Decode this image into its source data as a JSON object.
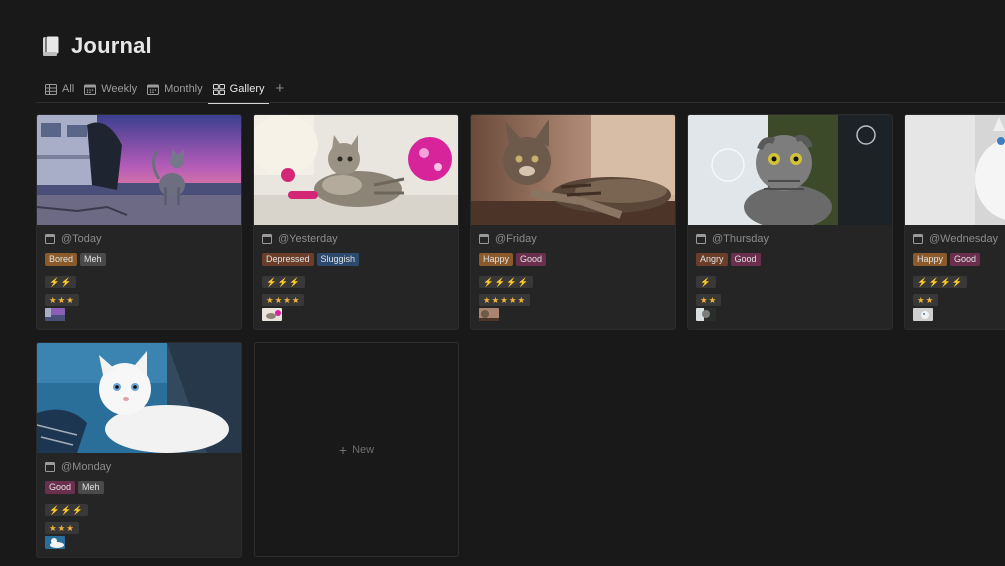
{
  "page": {
    "title": "Journal",
    "icon": "book-icon"
  },
  "tabs": [
    {
      "label": "All",
      "icon": "table-icon",
      "active": false
    },
    {
      "label": "Weekly",
      "icon": "calendar-icon",
      "active": false
    },
    {
      "label": "Monthly",
      "icon": "calendar-icon",
      "active": false
    },
    {
      "label": "Gallery",
      "icon": "gallery-icon",
      "active": true
    }
  ],
  "add_view_label": "+",
  "cards": [
    {
      "date": "@Today",
      "tags": [
        {
          "label": "Bored",
          "color": "#8a5a2b"
        },
        {
          "label": "Meh",
          "color": "#4a4a4a"
        }
      ],
      "energy": "⚡⚡",
      "stars": "★★★",
      "cover": "cat-on-beach-sunset"
    },
    {
      "date": "@Yesterday",
      "tags": [
        {
          "label": "Depressed",
          "color": "#6b3e2a"
        },
        {
          "label": "Sluggish",
          "color": "#2c4a6e"
        }
      ],
      "energy": "⚡⚡⚡",
      "stars": "★★★★",
      "cover": "kitten-with-pink-ball"
    },
    {
      "date": "@Friday",
      "tags": [
        {
          "label": "Happy",
          "color": "#8a5a2b"
        },
        {
          "label": "Good",
          "color": "#6b2f4e"
        }
      ],
      "energy": "⚡⚡⚡⚡",
      "stars": "★★★★★",
      "cover": "tabby-lying-on-floor"
    },
    {
      "date": "@Thursday",
      "tags": [
        {
          "label": "Angry",
          "color": "#6b3e2a"
        },
        {
          "label": "Good",
          "color": "#6b2f4e"
        }
      ],
      "energy": "⚡",
      "stars": "★★",
      "cover": "scottish-fold-bubbles"
    },
    {
      "date": "@Wednesday",
      "tags": [
        {
          "label": "Happy",
          "color": "#8a5a2b"
        },
        {
          "label": "Good",
          "color": "#6b2f4e"
        }
      ],
      "energy": "⚡⚡⚡⚡",
      "stars": "★★",
      "cover": "white-cat-blue-eyes"
    },
    {
      "date": "@Monday",
      "tags": [
        {
          "label": "Good",
          "color": "#6b2f4e"
        },
        {
          "label": "Meh",
          "color": "#4a4a4a"
        }
      ],
      "energy": "⚡⚡⚡",
      "stars": "★★★",
      "cover": "white-fluffy-cat"
    }
  ],
  "new_card_label": "New",
  "new_card_icon": "plus-icon"
}
